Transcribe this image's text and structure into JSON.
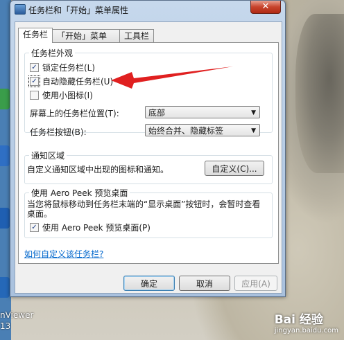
{
  "window": {
    "title": "任务栏和「开始」菜单属性",
    "close_label": "✕"
  },
  "tabs": [
    {
      "label": "任务栏",
      "active": true
    },
    {
      "label": "「开始」菜单",
      "active": false
    },
    {
      "label": "工具栏",
      "active": false
    }
  ],
  "appearance": {
    "legend": "任务栏外观",
    "lock_label": "锁定任务栏(L)",
    "lock_checked": true,
    "autohide_label": "自动隐藏任务栏(U)",
    "autohide_checked": true,
    "small_icons_label": "使用小图标(I)",
    "small_icons_checked": false,
    "position_label": "屏幕上的任务栏位置(T):",
    "position_value": "底部",
    "buttons_label": "任务栏按钮(B):",
    "buttons_value": "始终合并、隐藏标签"
  },
  "notify": {
    "legend": "通知区域",
    "text": "自定义通知区域中出现的图标和通知。",
    "customize_button": "自定义(C)..."
  },
  "peek": {
    "legend": "使用 Aero Peek 预览桌面",
    "desc": "当您将鼠标移动到任务栏末端的“显示桌面”按钮时，会暂时查看桌面。",
    "checkbox_label": "使用 Aero Peek 预览桌面(P)",
    "checked": true
  },
  "link_text": "如何自定义该任务栏?",
  "buttons": {
    "ok": "确定",
    "cancel": "取消",
    "apply": "应用(A)"
  },
  "desktop": {
    "text_1": "nViewer",
    "text_2": "13",
    "watermark": "Bai 经验",
    "watermark_url": "jingyan.baidu.com"
  },
  "colors": {
    "annotation_arrow": "#e02020",
    "checkmark": "#1b3c84",
    "link": "#0066cc"
  }
}
